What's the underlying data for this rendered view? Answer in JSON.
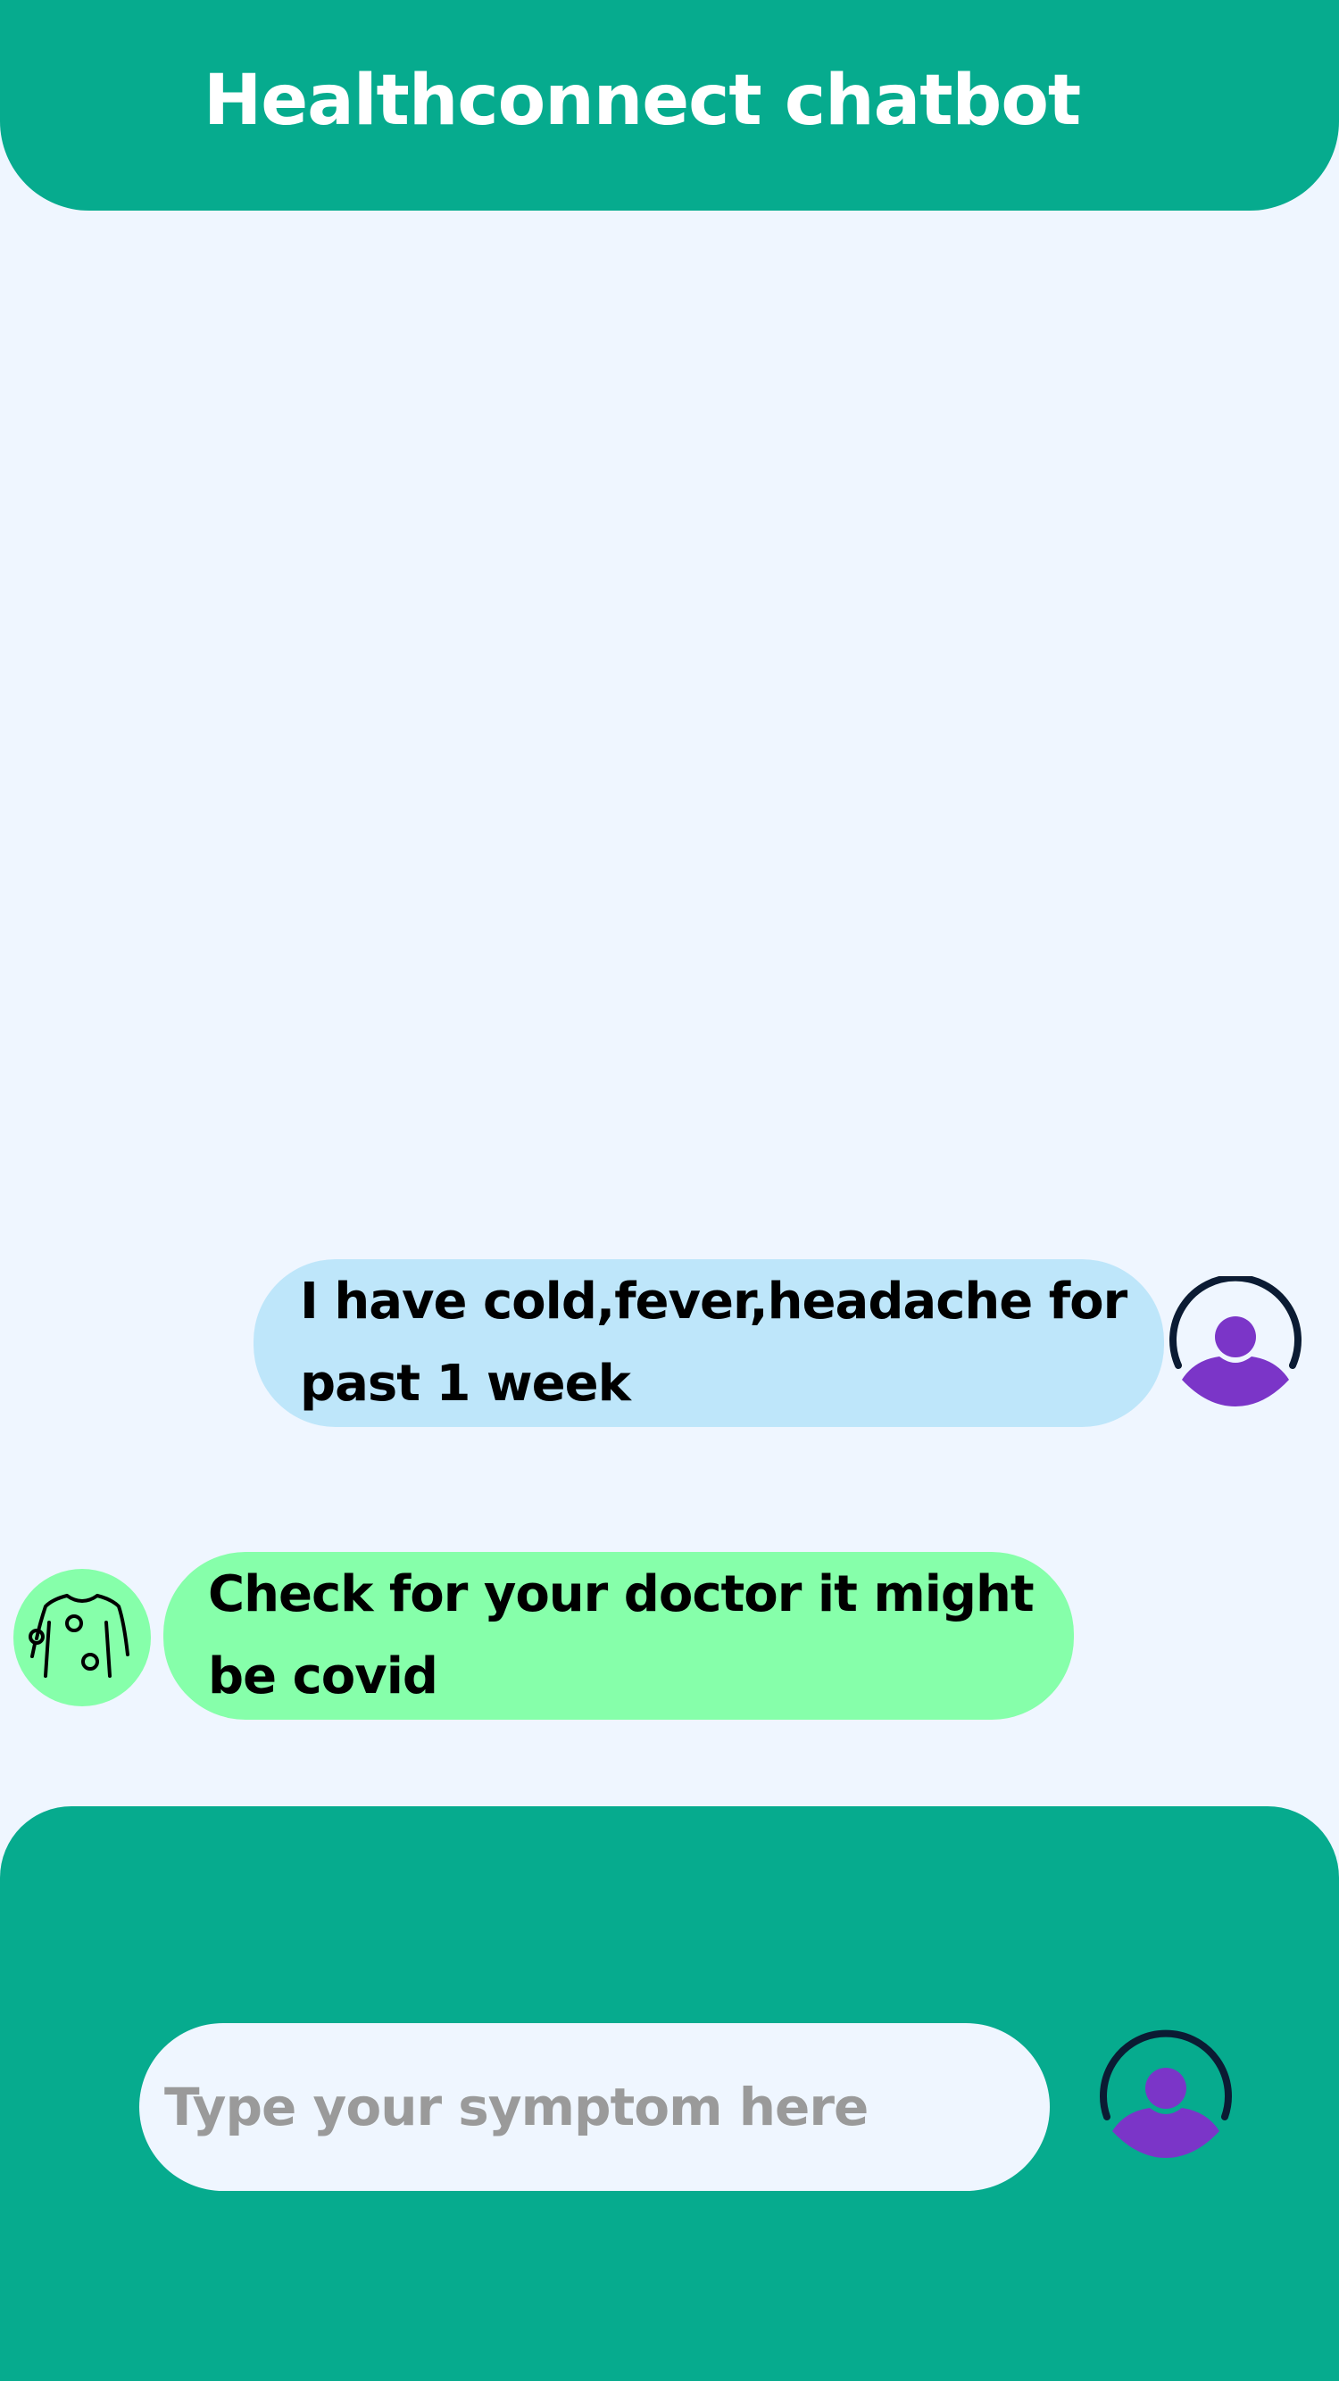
{
  "app": {
    "title": "Healthconnect chatbot"
  },
  "colors": {
    "primary": "#06AB8E",
    "background": "#EFF6FF",
    "user_bubble": "#BEE6FA",
    "bot_bubble": "#86FFAA",
    "avatar_accent": "#7B35C8",
    "avatar_ring": "#0B1B33"
  },
  "messages": [
    {
      "sender": "user",
      "lines": [
        "I have cold,fever,headache for",
        "past 1 week"
      ],
      "icon": "user-avatar-icon"
    },
    {
      "sender": "bot",
      "lines": [
        "Check for your doctor it might",
        "be covid"
      ],
      "icon": "patient-body-icon"
    }
  ],
  "composer": {
    "placeholder": "Type your symptom here",
    "value": "",
    "send_icon": "user-avatar-icon"
  }
}
